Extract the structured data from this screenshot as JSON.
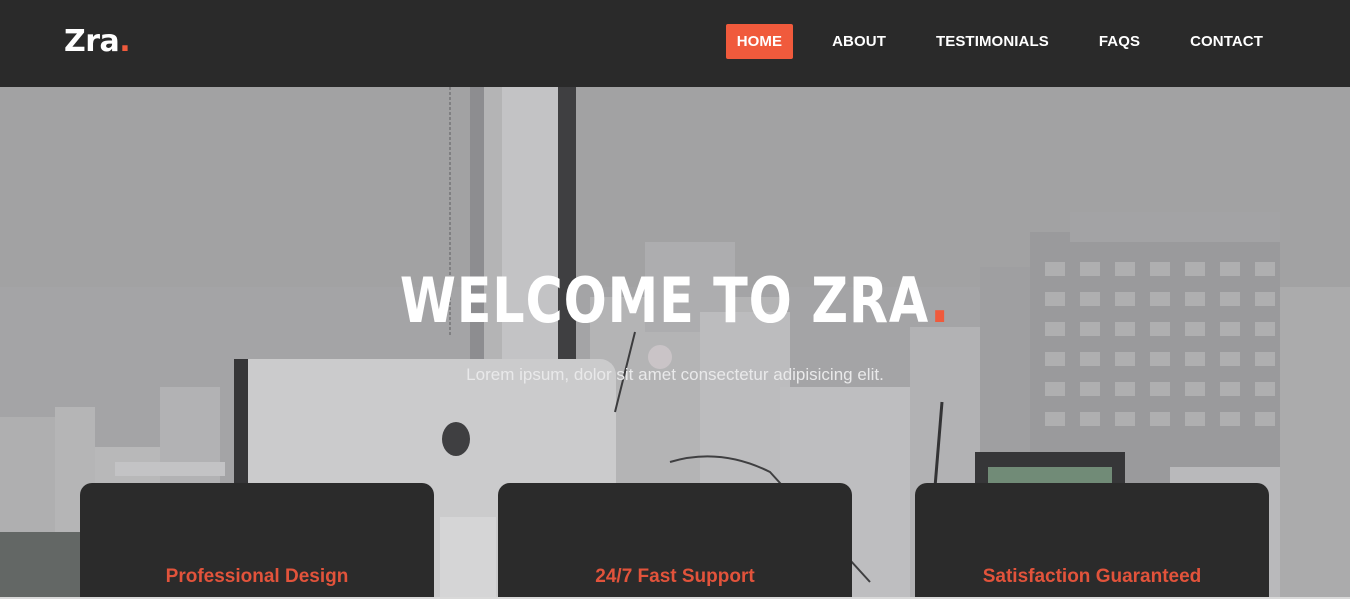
{
  "brand": {
    "name": "Zra",
    "dot": "."
  },
  "nav": {
    "items": [
      {
        "label": "HOME",
        "active": true
      },
      {
        "label": "ABOUT",
        "active": false
      },
      {
        "label": "TESTIMONIALS",
        "active": false
      },
      {
        "label": "FAQS",
        "active": false
      },
      {
        "label": "CONTACT",
        "active": false
      }
    ]
  },
  "hero": {
    "title": "WELCOME TO ZRA",
    "title_dot": ".",
    "subtitle": "Lorem ipsum, dolor sit amet consectetur adipisicing elit."
  },
  "features": [
    {
      "label": "Professional Design"
    },
    {
      "label": "24/7 Fast Support"
    },
    {
      "label": "Satisfaction Guaranteed"
    }
  ],
  "colors": {
    "accent": "#f05a3c",
    "navbar_bg": "#2a2a2a",
    "card_bg": "#2b2b2b",
    "card_label": "#e2533b"
  }
}
